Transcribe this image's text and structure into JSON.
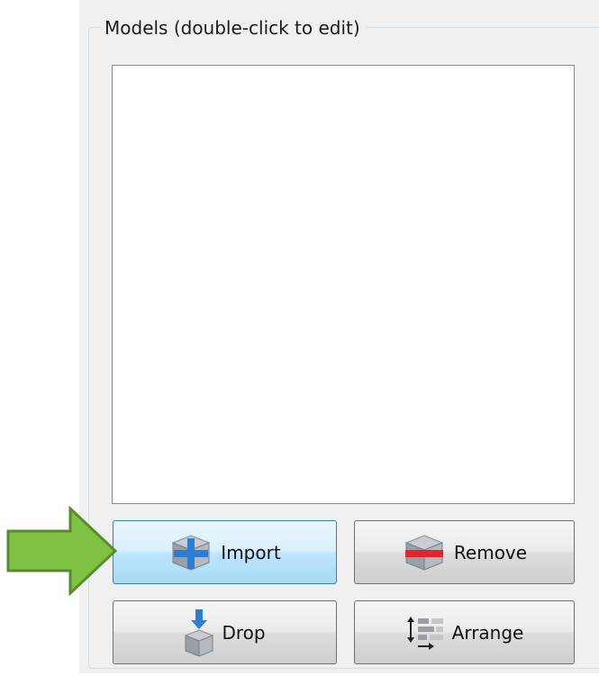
{
  "models_group": {
    "title": "Models (double-click to edit)"
  },
  "buttons": {
    "import_label": "Import",
    "remove_label": "Remove",
    "drop_label": "Drop",
    "arrange_label": "Arrange"
  },
  "icons": {
    "import": "cube-plus-icon",
    "remove": "cube-minus-icon",
    "drop": "cube-drop-icon",
    "arrange": "arrange-icon",
    "pointer": "green-arrow-icon"
  },
  "colors": {
    "arrow_fill": "#7dc242",
    "arrow_stroke": "#5a8a2f",
    "focused_button": "#bee6fd"
  }
}
